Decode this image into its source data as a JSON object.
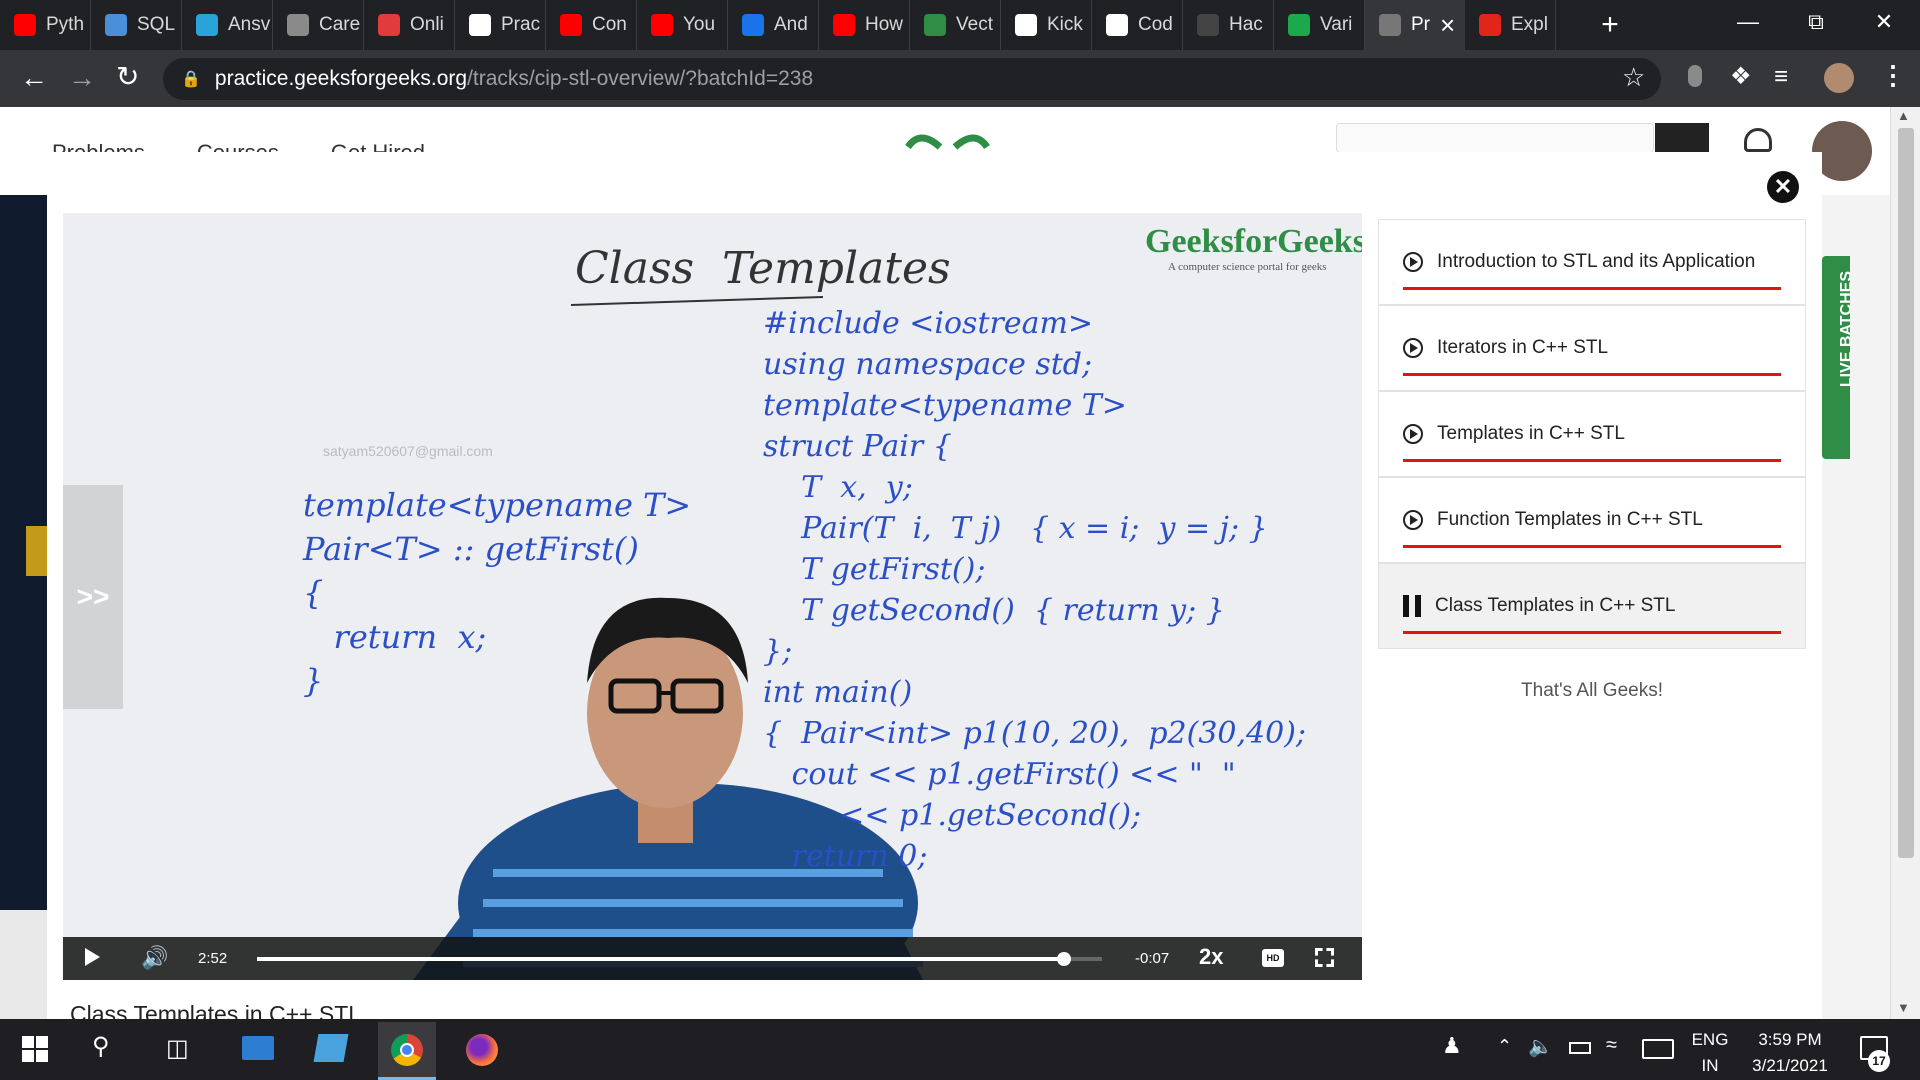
{
  "browser": {
    "tabs": [
      {
        "label": "Pyth",
        "icon": "youtube-icon",
        "color": "#ff0000"
      },
      {
        "label": "SQL",
        "icon": "document-icon",
        "color": "#4a90d9"
      },
      {
        "label": "Ansv",
        "icon": "globe-icon",
        "color": "#2aa3d8"
      },
      {
        "label": "Care",
        "icon": "ampersand-icon",
        "color": "#8a8a8a"
      },
      {
        "label": "Onli",
        "icon": "udemy-icon",
        "color": "#e23b3b"
      },
      {
        "label": "Prac",
        "icon": "globe-icon",
        "color": "#ffffff"
      },
      {
        "label": "Con",
        "icon": "youtube-icon",
        "color": "#ff0000"
      },
      {
        "label": "You",
        "icon": "youtube-icon",
        "color": "#ff0000"
      },
      {
        "label": "And",
        "icon": "play-box-icon",
        "color": "#1a73e8"
      },
      {
        "label": "How",
        "icon": "youtube-icon",
        "color": "#ff0000"
      },
      {
        "label": "Vect",
        "icon": "gfg-icon",
        "color": "#2f8d46"
      },
      {
        "label": "Kick",
        "icon": "google-icon",
        "color": "#ffffff"
      },
      {
        "label": "Cod",
        "icon": "google-icon",
        "color": "#ffffff"
      },
      {
        "label": "Hac",
        "icon": "github-icon",
        "color": "#444444"
      },
      {
        "label": "Vari",
        "icon": "hackerrank-icon",
        "color": "#1ba94c"
      },
      {
        "label": "Pr",
        "icon": "mute-icon",
        "color": "#777777",
        "active": true
      },
      {
        "label": "Expl",
        "icon": "adobe-icon",
        "color": "#e1251b"
      }
    ],
    "close_tab": "×",
    "new_tab": "+",
    "url_host": "practice.geeksforgeeks.org",
    "url_path": "/tracks/cip-stl-overview/?batchId=238"
  },
  "site_header": {
    "nav": [
      "Problems",
      "Courses",
      "Get Hired"
    ],
    "side_badge": "LIVE BATCHES"
  },
  "video": {
    "watermark": "GeeksforGeeks",
    "watermark_sub": "A computer science portal for geeks",
    "viewer_email": "satyam520607@gmail.com",
    "whiteboard_title": "Class  Templates",
    "whiteboard_code_right": [
      "#include <iostream>",
      "using namespace std;",
      "template<typename T>",
      "struct Pair {",
      "    T  x,  y;",
      "    Pair(T  i,  T j)   { x = i;  y = j; }",
      "    T getFirst();",
      "    T getSecond()  { return y; }",
      "};",
      "int main()",
      "{  Pair<int> p1(10, 20),  p2(30,40);",
      "   cout << p1.getFirst() << \"  \"",
      "        << p1.getSecond();",
      "   return 0;"
    ],
    "whiteboard_code_left": [
      "template<typename T>",
      "Pair<T> :: getFirst()",
      "{",
      "   return  x;",
      "}"
    ],
    "sidebar_toggle": ">>",
    "current_time": "2:52",
    "remaining_time": "-0:07",
    "speed": "2x",
    "hd_label": "HD",
    "progress": 0.955
  },
  "playlist": {
    "items": [
      {
        "title": "Introduction to STL and its Application",
        "state": "done"
      },
      {
        "title": "Iterators in C++ STL",
        "state": "done"
      },
      {
        "title": "Templates in C++ STL",
        "state": "done"
      },
      {
        "title": "Function Templates in C++ STL",
        "state": "done"
      },
      {
        "title": "Class Templates in C++ STL",
        "state": "playing"
      }
    ],
    "footer": "That's All Geeks!"
  },
  "lesson_title": "Class Templates in C++ STL",
  "taskbar": {
    "lang_top": "ENG",
    "lang_bottom": "IN",
    "time": "3:59 PM",
    "date": "3/21/2021",
    "notifications": "17"
  }
}
